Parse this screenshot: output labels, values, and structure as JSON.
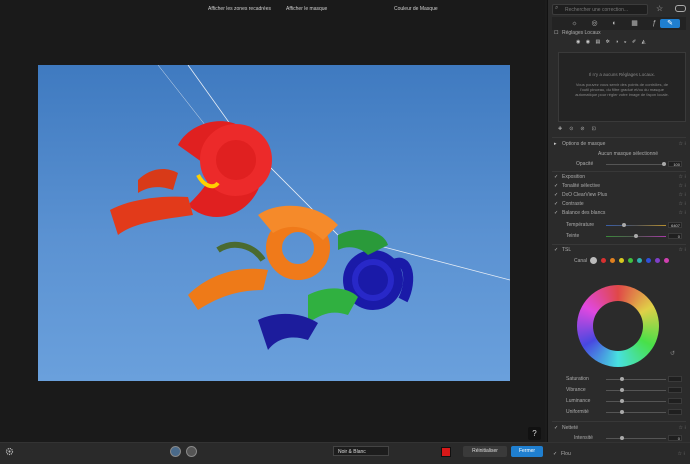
{
  "viewer": {
    "help_label": "?"
  },
  "bottom_bar": {
    "show_crop_zones": "Afficher les zones recadrées",
    "show_mask": "Afficher le masque",
    "mask_mode_selected": "Noir & Blanc",
    "mask_color_label": "Couleur de Masque",
    "mask_color": "#d81818",
    "reset_label": "Réinitialiser",
    "close_label": "Fermer",
    "accent": "#1f7fd0"
  },
  "panel": {
    "search_placeholder": "Rechercher une correction...",
    "tools": [
      "sun-icon",
      "circles-icon",
      "palette-icon",
      "layers-icon",
      "fx-icon",
      "eyedropper-icon"
    ],
    "local_settings": {
      "title": "Réglages Locaux",
      "empty_title": "Il n'y a aucuns Réglages Locaux.",
      "empty_text": "Vous pouvez vous servir des points de contrôles, de l'outil pinceau, du filtre gradué et/ou du masque automatique pour régler votre image de façon locale."
    },
    "mask_options": {
      "title": "Options de masque",
      "no_mask": "Aucun masque sélectionné",
      "opacity_label": "Opacité",
      "opacity_value": "100"
    },
    "corrections": [
      {
        "label": "Exposition"
      },
      {
        "label": "Tonalité sélective"
      },
      {
        "label": "DxO ClearView Plus"
      },
      {
        "label": "Contraste"
      },
      {
        "label": "Balance des blancs"
      }
    ],
    "white_balance": {
      "temperature_label": "Température",
      "temperature_value": "6407",
      "tint_label": "Teinte",
      "tint_value": "0"
    },
    "tsl": {
      "title": "TSL",
      "channel_label": "Canal",
      "channel_colors": [
        "#bbbbbb",
        "#d83030",
        "#e08020",
        "#d8c820",
        "#40c040",
        "#30b0b0",
        "#3050d8",
        "#8040c8",
        "#d040b0"
      ],
      "saturation_label": "Saturation",
      "vibrance_label": "Vibrance",
      "luminance_label": "Luminance",
      "uniformity_label": "Uniformité"
    },
    "sharpness": {
      "title": "Netteté",
      "intensity_label": "Intensité",
      "intensity_value": "0"
    },
    "flou_label": "Flou"
  }
}
